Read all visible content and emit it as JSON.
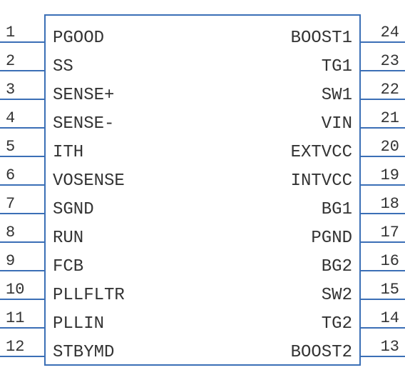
{
  "chip": {
    "left_pins": [
      {
        "num": "1",
        "label": "PGOOD"
      },
      {
        "num": "2",
        "label": "SS"
      },
      {
        "num": "3",
        "label": "SENSE+"
      },
      {
        "num": "4",
        "label": "SENSE-"
      },
      {
        "num": "5",
        "label": "ITH"
      },
      {
        "num": "6",
        "label": "VOSENSE"
      },
      {
        "num": "7",
        "label": "SGND"
      },
      {
        "num": "8",
        "label": "RUN"
      },
      {
        "num": "9",
        "label": "FCB"
      },
      {
        "num": "10",
        "label": "PLLFLTR"
      },
      {
        "num": "11",
        "label": "PLLIN"
      },
      {
        "num": "12",
        "label": "STBYMD"
      }
    ],
    "right_pins": [
      {
        "num": "24",
        "label": "BOOST1"
      },
      {
        "num": "23",
        "label": "TG1"
      },
      {
        "num": "22",
        "label": "SW1"
      },
      {
        "num": "21",
        "label": "VIN"
      },
      {
        "num": "20",
        "label": "EXTVCC"
      },
      {
        "num": "19",
        "label": "INTVCC"
      },
      {
        "num": "18",
        "label": "BG1"
      },
      {
        "num": "17",
        "label": "PGND"
      },
      {
        "num": "16",
        "label": "BG2"
      },
      {
        "num": "15",
        "label": "SW2"
      },
      {
        "num": "14",
        "label": "TG2"
      },
      {
        "num": "13",
        "label": "BOOST2"
      }
    ]
  }
}
